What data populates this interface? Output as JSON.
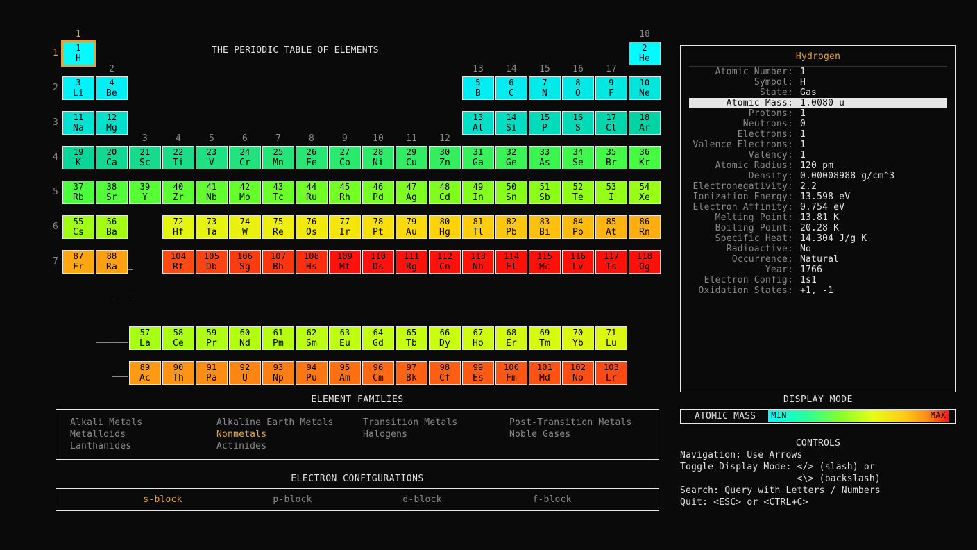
{
  "title": "THE PERIODIC TABLE OF ELEMENTS",
  "selected_symbol": "H",
  "display_mode_label": "ATOMIC MASS",
  "gradient": {
    "min": "MIN",
    "max": "MAX"
  },
  "panels": {
    "families_title": "ELEMENT FAMILIES",
    "configs_title": "ELECTRON CONFIGURATIONS",
    "display_mode_title": "DISPLAY MODE",
    "controls_title": "CONTROLS"
  },
  "families": [
    {
      "label": "Alkali Metals",
      "hl": false
    },
    {
      "label": "Alkaline Earth Metals",
      "hl": false
    },
    {
      "label": "Transition Metals",
      "hl": false
    },
    {
      "label": "Post-Transition Metals",
      "hl": false
    },
    {
      "label": "Metalloids",
      "hl": false
    },
    {
      "label": "Nonmetals",
      "hl": true
    },
    {
      "label": "Halogens",
      "hl": false
    },
    {
      "label": "Noble Gases",
      "hl": false
    },
    {
      "label": "Lanthanides",
      "hl": false
    },
    {
      "label": "Actinides",
      "hl": false
    }
  ],
  "blocks": [
    {
      "label": "s-block",
      "hl": true
    },
    {
      "label": "p-block",
      "hl": false
    },
    {
      "label": "d-block",
      "hl": false
    },
    {
      "label": "f-block",
      "hl": false
    }
  ],
  "controls": [
    "Navigation: Use Arrows",
    "Toggle Display Mode: </> (slash) or",
    "                     <\\> (backslash)",
    "Search: Query with Letters / Numbers",
    "Quit: <ESC> or <CTRL+C>"
  ],
  "details": {
    "name": "Hydrogen",
    "highlight_index": 3,
    "rows": [
      {
        "k": "Atomic Number",
        "v": "1"
      },
      {
        "k": "Symbol",
        "v": "H"
      },
      {
        "k": "State",
        "v": "Gas"
      },
      {
        "k": "Atomic Mass",
        "v": "1.0080 u"
      },
      {
        "k": "Protons",
        "v": "1"
      },
      {
        "k": "Neutrons",
        "v": "0"
      },
      {
        "k": "Electrons",
        "v": "1"
      },
      {
        "k": "Valence Electrons",
        "v": "1"
      },
      {
        "k": "Valency",
        "v": "1"
      },
      {
        "k": "Atomic Radius",
        "v": "120 pm"
      },
      {
        "k": "Density",
        "v": "0.00008988 g/cm^3"
      },
      {
        "k": "Electronegativity",
        "v": "2.2"
      },
      {
        "k": "Ionization Energy",
        "v": "13.598 eV"
      },
      {
        "k": "Electron Affinity",
        "v": "0.754 eV"
      },
      {
        "k": "Melting Point",
        "v": "13.81 K"
      },
      {
        "k": "Boiling Point",
        "v": "20.28 K"
      },
      {
        "k": "Specific Heat",
        "v": "14.304 J/g K"
      },
      {
        "k": "Radioactive",
        "v": "No"
      },
      {
        "k": "Occurrence",
        "v": "Natural"
      },
      {
        "k": "Year",
        "v": "1766"
      },
      {
        "k": "Electron Config",
        "v": "1s1"
      },
      {
        "k": "Oxidation States",
        "v": "+1, -1"
      }
    ]
  },
  "elements": [
    {
      "n": 1,
      "s": "H",
      "r": 1,
      "c": 1,
      "bg": "#00fcff"
    },
    {
      "n": 2,
      "s": "He",
      "r": 1,
      "c": 18,
      "bg": "#00fcff"
    },
    {
      "n": 3,
      "s": "Li",
      "r": 2,
      "c": 1,
      "bg": "#00f3f8"
    },
    {
      "n": 4,
      "s": "Be",
      "r": 2,
      "c": 2,
      "bg": "#00f0f5"
    },
    {
      "n": 5,
      "s": "B",
      "r": 2,
      "c": 13,
      "bg": "#00eef2"
    },
    {
      "n": 6,
      "s": "C",
      "r": 2,
      "c": 14,
      "bg": "#00ecee"
    },
    {
      "n": 7,
      "s": "N",
      "r": 2,
      "c": 15,
      "bg": "#00eaea"
    },
    {
      "n": 8,
      "s": "O",
      "r": 2,
      "c": 16,
      "bg": "#00e9e7"
    },
    {
      "n": 9,
      "s": "F",
      "r": 2,
      "c": 17,
      "bg": "#00e8e1"
    },
    {
      "n": 10,
      "s": "Ne",
      "r": 2,
      "c": 18,
      "bg": "#00e6dc"
    },
    {
      "n": 11,
      "s": "Na",
      "r": 3,
      "c": 1,
      "bg": "#00e3d3"
    },
    {
      "n": 12,
      "s": "Mg",
      "r": 3,
      "c": 2,
      "bg": "#00e1cd"
    },
    {
      "n": 13,
      "s": "Al",
      "r": 3,
      "c": 13,
      "bg": "#00dfc8"
    },
    {
      "n": 14,
      "s": "Si",
      "r": 3,
      "c": 14,
      "bg": "#00ddc2"
    },
    {
      "n": 15,
      "s": "P",
      "r": 3,
      "c": 15,
      "bg": "#00dbbc"
    },
    {
      "n": 16,
      "s": "S",
      "r": 3,
      "c": 16,
      "bg": "#00dab6"
    },
    {
      "n": 17,
      "s": "Cl",
      "r": 3,
      "c": 17,
      "bg": "#00d6ad"
    },
    {
      "n": 18,
      "s": "Ar",
      "r": 3,
      "c": 18,
      "bg": "#00d3a4"
    },
    {
      "n": 19,
      "s": "K",
      "r": 4,
      "c": 1,
      "bg": "#0ad69a"
    },
    {
      "n": 20,
      "s": "Ca",
      "r": 4,
      "c": 2,
      "bg": "#12d893"
    },
    {
      "n": 21,
      "s": "Sc",
      "r": 4,
      "c": 3,
      "bg": "#17da8e"
    },
    {
      "n": 22,
      "s": "Ti",
      "r": 4,
      "c": 4,
      "bg": "#1bdd88"
    },
    {
      "n": 23,
      "s": "V",
      "r": 4,
      "c": 5,
      "bg": "#1fe083"
    },
    {
      "n": 24,
      "s": "Cr",
      "r": 4,
      "c": 6,
      "bg": "#22e27e"
    },
    {
      "n": 25,
      "s": "Mn",
      "r": 4,
      "c": 7,
      "bg": "#25e479"
    },
    {
      "n": 26,
      "s": "Fe",
      "r": 4,
      "c": 8,
      "bg": "#28e674"
    },
    {
      "n": 27,
      "s": "Co",
      "r": 4,
      "c": 9,
      "bg": "#2be86f"
    },
    {
      "n": 28,
      "s": "Ni",
      "r": 4,
      "c": 10,
      "bg": "#2eea6a"
    },
    {
      "n": 29,
      "s": "Cu",
      "r": 4,
      "c": 11,
      "bg": "#31ec65"
    },
    {
      "n": 30,
      "s": "Zn",
      "r": 4,
      "c": 12,
      "bg": "#34ee60"
    },
    {
      "n": 31,
      "s": "Ga",
      "r": 4,
      "c": 13,
      "bg": "#37f05b"
    },
    {
      "n": 32,
      "s": "Ge",
      "r": 4,
      "c": 14,
      "bg": "#3af356"
    },
    {
      "n": 33,
      "s": "As",
      "r": 4,
      "c": 15,
      "bg": "#3df551"
    },
    {
      "n": 34,
      "s": "Se",
      "r": 4,
      "c": 16,
      "bg": "#40f84c"
    },
    {
      "n": 35,
      "s": "Br",
      "r": 4,
      "c": 17,
      "bg": "#43fa47"
    },
    {
      "n": 36,
      "s": "Kr",
      "r": 4,
      "c": 18,
      "bg": "#46fc42"
    },
    {
      "n": 37,
      "s": "Rb",
      "r": 5,
      "c": 1,
      "bg": "#4cff3c"
    },
    {
      "n": 38,
      "s": "Sr",
      "r": 5,
      "c": 2,
      "bg": "#52ff38"
    },
    {
      "n": 39,
      "s": "Y",
      "r": 5,
      "c": 3,
      "bg": "#57ff35"
    },
    {
      "n": 40,
      "s": "Zr",
      "r": 5,
      "c": 4,
      "bg": "#5cff32"
    },
    {
      "n": 41,
      "s": "Nb",
      "r": 5,
      "c": 5,
      "bg": "#61ff2f"
    },
    {
      "n": 42,
      "s": "Mo",
      "r": 5,
      "c": 6,
      "bg": "#66ff2c"
    },
    {
      "n": 43,
      "s": "Tc",
      "r": 5,
      "c": 7,
      "bg": "#6bff29"
    },
    {
      "n": 44,
      "s": "Ru",
      "r": 5,
      "c": 8,
      "bg": "#70ff27"
    },
    {
      "n": 45,
      "s": "Rh",
      "r": 5,
      "c": 9,
      "bg": "#74ff25"
    },
    {
      "n": 46,
      "s": "Pd",
      "r": 5,
      "c": 10,
      "bg": "#78ff23"
    },
    {
      "n": 47,
      "s": "Ag",
      "r": 5,
      "c": 11,
      "bg": "#7cff21"
    },
    {
      "n": 48,
      "s": "Cd",
      "r": 5,
      "c": 12,
      "bg": "#80ff1f"
    },
    {
      "n": 49,
      "s": "In",
      "r": 5,
      "c": 13,
      "bg": "#84ff1d"
    },
    {
      "n": 50,
      "s": "Sn",
      "r": 5,
      "c": 14,
      "bg": "#88ff1b"
    },
    {
      "n": 51,
      "s": "Sb",
      "r": 5,
      "c": 15,
      "bg": "#8cff19"
    },
    {
      "n": 52,
      "s": "Te",
      "r": 5,
      "c": 16,
      "bg": "#90ff18"
    },
    {
      "n": 53,
      "s": "I",
      "r": 5,
      "c": 17,
      "bg": "#94ff17"
    },
    {
      "n": 54,
      "s": "Xe",
      "r": 5,
      "c": 18,
      "bg": "#98ff16"
    },
    {
      "n": 55,
      "s": "Cs",
      "r": 6,
      "c": 1,
      "bg": "#9eff15"
    },
    {
      "n": 56,
      "s": "Ba",
      "r": 6,
      "c": 2,
      "bg": "#a2ff14"
    },
    {
      "n": 72,
      "s": "Hf",
      "r": 6,
      "c": 4,
      "bg": "#e2f610"
    },
    {
      "n": 73,
      "s": "Ta",
      "r": 6,
      "c": 5,
      "bg": "#e6f40f"
    },
    {
      "n": 74,
      "s": "W",
      "r": 6,
      "c": 6,
      "bg": "#eaf10e"
    },
    {
      "n": 75,
      "s": "Re",
      "r": 6,
      "c": 7,
      "bg": "#eeef0d"
    },
    {
      "n": 76,
      "s": "Os",
      "r": 6,
      "c": 8,
      "bg": "#f2ea0c"
    },
    {
      "n": 77,
      "s": "Ir",
      "r": 6,
      "c": 9,
      "bg": "#f5e50b"
    },
    {
      "n": 78,
      "s": "Pt",
      "r": 6,
      "c": 10,
      "bg": "#f8df0a"
    },
    {
      "n": 79,
      "s": "Au",
      "r": 6,
      "c": 11,
      "bg": "#fcd90a"
    },
    {
      "n": 80,
      "s": "Hg",
      "r": 6,
      "c": 12,
      "bg": "#ffd30a"
    },
    {
      "n": 81,
      "s": "Tl",
      "r": 6,
      "c": 13,
      "bg": "#ffcd0b"
    },
    {
      "n": 82,
      "s": "Pb",
      "r": 6,
      "c": 14,
      "bg": "#ffc70c"
    },
    {
      "n": 83,
      "s": "Bi",
      "r": 6,
      "c": 15,
      "bg": "#ffc10d"
    },
    {
      "n": 84,
      "s": "Po",
      "r": 6,
      "c": 16,
      "bg": "#ffba0e"
    },
    {
      "n": 85,
      "s": "At",
      "r": 6,
      "c": 17,
      "bg": "#ffb40f"
    },
    {
      "n": 86,
      "s": "Rn",
      "r": 6,
      "c": 18,
      "bg": "#ffad10"
    },
    {
      "n": 87,
      "s": "Fr",
      "r": 7,
      "c": 1,
      "bg": "#ffa711"
    },
    {
      "n": 88,
      "s": "Ra",
      "r": 7,
      "c": 2,
      "bg": "#ffa112"
    },
    {
      "n": 104,
      "s": "Rf",
      "r": 7,
      "c": 4,
      "bg": "#ff4a13"
    },
    {
      "n": 105,
      "s": "Db",
      "r": 7,
      "c": 5,
      "bg": "#ff4312"
    },
    {
      "n": 106,
      "s": "Sg",
      "r": 7,
      "c": 6,
      "bg": "#ff3c11"
    },
    {
      "n": 107,
      "s": "Bh",
      "r": 7,
      "c": 7,
      "bg": "#ff3510"
    },
    {
      "n": 108,
      "s": "Hs",
      "r": 7,
      "c": 8,
      "bg": "#ff2e0f"
    },
    {
      "n": 109,
      "s": "Mt",
      "r": 7,
      "c": 9,
      "bg": "#ff120e"
    },
    {
      "n": 110,
      "s": "Ds",
      "r": 7,
      "c": 10,
      "bg": "#ff120d"
    },
    {
      "n": 111,
      "s": "Rg",
      "r": 7,
      "c": 11,
      "bg": "#ff120c"
    },
    {
      "n": 112,
      "s": "Cn",
      "r": 7,
      "c": 12,
      "bg": "#ff120b"
    },
    {
      "n": 113,
      "s": "Nh",
      "r": 7,
      "c": 13,
      "bg": "#ff120a"
    },
    {
      "n": 114,
      "s": "Fl",
      "r": 7,
      "c": 14,
      "bg": "#ff1109"
    },
    {
      "n": 115,
      "s": "Mc",
      "r": 7,
      "c": 15,
      "bg": "#ff1008"
    },
    {
      "n": 116,
      "s": "Lv",
      "r": 7,
      "c": 16,
      "bg": "#ff1008"
    },
    {
      "n": 117,
      "s": "Ts",
      "r": 7,
      "c": 17,
      "bg": "#ff1008"
    },
    {
      "n": 118,
      "s": "Og",
      "r": 7,
      "c": 18,
      "bg": "#ff1008"
    },
    {
      "n": 57,
      "s": "La",
      "r": 9,
      "c": 3,
      "bg": "#a6ff14"
    },
    {
      "n": 58,
      "s": "Ce",
      "r": 9,
      "c": 4,
      "bg": "#aaff13"
    },
    {
      "n": 59,
      "s": "Pr",
      "r": 9,
      "c": 5,
      "bg": "#aeff13"
    },
    {
      "n": 60,
      "s": "Nd",
      "r": 9,
      "c": 6,
      "bg": "#b2ff12"
    },
    {
      "n": 61,
      "s": "Pm",
      "r": 9,
      "c": 7,
      "bg": "#b6ff12"
    },
    {
      "n": 62,
      "s": "Sm",
      "r": 9,
      "c": 8,
      "bg": "#baff12"
    },
    {
      "n": 63,
      "s": "Eu",
      "r": 9,
      "c": 9,
      "bg": "#beff11"
    },
    {
      "n": 64,
      "s": "Gd",
      "r": 9,
      "c": 10,
      "bg": "#c2ff11"
    },
    {
      "n": 65,
      "s": "Tb",
      "r": 9,
      "c": 11,
      "bg": "#c6fe10"
    },
    {
      "n": 66,
      "s": "Dy",
      "r": 9,
      "c": 12,
      "bg": "#cafe10"
    },
    {
      "n": 67,
      "s": "Ho",
      "r": 9,
      "c": 13,
      "bg": "#cefc10"
    },
    {
      "n": 68,
      "s": "Er",
      "r": 9,
      "c": 14,
      "bg": "#d2fb10"
    },
    {
      "n": 69,
      "s": "Tm",
      "r": 9,
      "c": 15,
      "bg": "#d6fa10"
    },
    {
      "n": 70,
      "s": "Yb",
      "r": 9,
      "c": 16,
      "bg": "#daf810"
    },
    {
      "n": 71,
      "s": "Lu",
      "r": 9,
      "c": 17,
      "bg": "#def710"
    },
    {
      "n": 89,
      "s": "Ac",
      "r": 10,
      "c": 3,
      "bg": "#ff9a13"
    },
    {
      "n": 90,
      "s": "Th",
      "r": 10,
      "c": 4,
      "bg": "#ff9313"
    },
    {
      "n": 91,
      "s": "Pa",
      "r": 10,
      "c": 5,
      "bg": "#ff8c13"
    },
    {
      "n": 92,
      "s": "U",
      "r": 10,
      "c": 6,
      "bg": "#ff8513"
    },
    {
      "n": 93,
      "s": "Np",
      "r": 10,
      "c": 7,
      "bg": "#ff7e13"
    },
    {
      "n": 94,
      "s": "Pu",
      "r": 10,
      "c": 8,
      "bg": "#ff7713"
    },
    {
      "n": 95,
      "s": "Am",
      "r": 10,
      "c": 9,
      "bg": "#ff7013"
    },
    {
      "n": 96,
      "s": "Cm",
      "r": 10,
      "c": 10,
      "bg": "#ff6913"
    },
    {
      "n": 97,
      "s": "Bk",
      "r": 10,
      "c": 11,
      "bg": "#ff6213"
    },
    {
      "n": 98,
      "s": "Cf",
      "r": 10,
      "c": 12,
      "bg": "#ff5e13"
    },
    {
      "n": 99,
      "s": "Es",
      "r": 10,
      "c": 13,
      "bg": "#ff5a13"
    },
    {
      "n": 100,
      "s": "Fm",
      "r": 10,
      "c": 14,
      "bg": "#ff5613"
    },
    {
      "n": 101,
      "s": "Md",
      "r": 10,
      "c": 15,
      "bg": "#ff5213"
    },
    {
      "n": 102,
      "s": "No",
      "r": 10,
      "c": 16,
      "bg": "#ff4e13"
    },
    {
      "n": 103,
      "s": "Lr",
      "r": 10,
      "c": 17,
      "bg": "#ff4a13"
    }
  ]
}
